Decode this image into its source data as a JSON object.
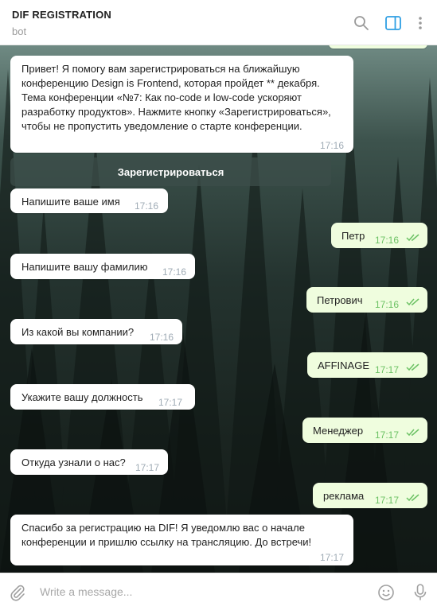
{
  "header": {
    "title": "DIF REGISTRATION",
    "subtitle": "bot"
  },
  "keyboard": {
    "register_label": "Зарегистрироваться"
  },
  "messages": [
    {
      "dir": "in",
      "text": "Привет! Я помогу вам зарегистрироваться на ближайшую конференцию Design is Frontend, которая пройдет ** декабря. Тема конференции «№7: Как no-code и low-code ускоряют разработку продуктов». Нажмите кнопку «Зарегистрироваться», чтобы не пропустить уведомление о старте конференции.",
      "time": "17:16"
    },
    {
      "dir": "in",
      "text": "Напишите ваше имя",
      "time": "17:16"
    },
    {
      "dir": "out",
      "text": "Петр",
      "time": "17:16"
    },
    {
      "dir": "in",
      "text": "Напишите вашу фамилию",
      "time": "17:16"
    },
    {
      "dir": "out",
      "text": "Петрович",
      "time": "17:16"
    },
    {
      "dir": "in",
      "text": "Из какой вы компании?",
      "time": "17:16"
    },
    {
      "dir": "out",
      "text": "AFFINAGE",
      "time": "17:17"
    },
    {
      "dir": "in",
      "text": "Укажите вашу должность",
      "time": "17:17"
    },
    {
      "dir": "out",
      "text": "Менеджер",
      "time": "17:17"
    },
    {
      "dir": "in",
      "text": "Откуда узнали о нас?",
      "time": "17:17"
    },
    {
      "dir": "out",
      "text": "реклама",
      "time": "17:17"
    },
    {
      "dir": "in",
      "text": "Спасибо за регистрацию на DIF! Я уведомлю вас о начале конференции и пришлю ссылку на трансляцию. До встречи!",
      "time": "17:17"
    }
  ],
  "composer": {
    "placeholder": "Write a message..."
  },
  "colors": {
    "incoming_bubble": "#ffffff",
    "outgoing_bubble": "#effdde",
    "read_check": "#6cc264",
    "accent": "#2e9fe3"
  }
}
